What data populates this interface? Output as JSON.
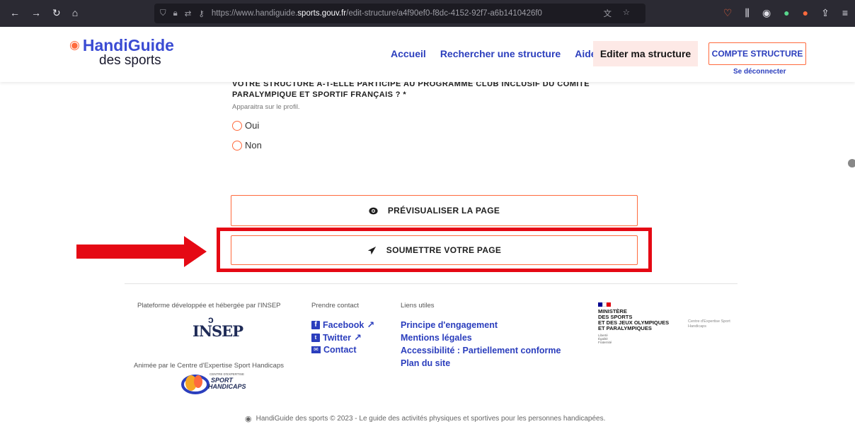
{
  "browser": {
    "url_prefix": "https://www.handiguide.",
    "url_domain": "sports.gouv.fr",
    "url_suffix": "/edit-structure/a4f90ef0-f8dc-4152-92f7-a6b1410426f0"
  },
  "header": {
    "logo_line1": "HandiGuide",
    "logo_line2": "des sports",
    "nav": [
      "Accueil",
      "Rechercher une structure",
      "Aide"
    ],
    "nav_active": "Editer ma structure",
    "account_button": "COMPTE STRUCTURE",
    "logout": "Se déconnecter"
  },
  "form": {
    "question_partial": "VOTRE STRUCTURE A-T-ELLE PARTICIPÉ AU PROGRAMME CLUB INCLUSIF DU COMITÉ",
    "question": "PARALYMPIQUE ET SPORTIF FRANÇAIS ? *",
    "hint": "Apparaitra sur le profil.",
    "options": [
      "Oui",
      "Non"
    ]
  },
  "actions": {
    "preview": "PRÉVISUALISER LA PAGE",
    "submit": "SOUMETTRE VOTRE PAGE"
  },
  "footer": {
    "developed_by": "Plateforme développée et hébergée par l'INSEP",
    "insep_logo": "INSEP",
    "animated_by": "Animée par le Centre d'Expertise Sport Handicaps",
    "csh_logo_small": "CENTRE D'EXPERTISE",
    "csh_logo_line1": "SPORT",
    "csh_logo_line2": "HANDICAPS",
    "contact_title": "Prendre contact",
    "contact_links": [
      "Facebook",
      "Twitter",
      "Contact"
    ],
    "links_title": "Liens utiles",
    "links": [
      "Principe d'engagement",
      "Mentions légales",
      "Accessibilité : Partiellement conforme",
      "Plan du site"
    ],
    "ministry_lines": [
      "MINISTÈRE",
      "DES SPORTS",
      "ET DES JEUX OLYMPIQUES",
      "ET PARALYMPIQUES"
    ],
    "ministry_motto": [
      "Liberté",
      "Égalité",
      "Fraternité"
    ],
    "ministry_side": "Centre d'Expertise Sport Handicaps",
    "copyright": "HandiGuide des sports © 2023 - Le guide des activités physiques et sportives pour les personnes handicapées."
  },
  "colors": {
    "brand_blue": "#2b3ebd",
    "accent_orange": "#ff6a3d",
    "highlight_red": "#e50914"
  }
}
